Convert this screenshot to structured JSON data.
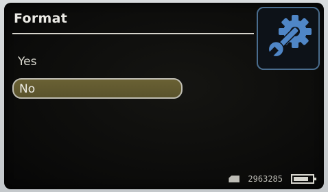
{
  "screen": {
    "title": "Format",
    "header_icon": "wrench-gear-icon"
  },
  "menu": {
    "items": [
      {
        "label": "Yes",
        "selected": false
      },
      {
        "label": "No",
        "selected": true
      }
    ]
  },
  "status": {
    "card_icon": "sd-card-icon",
    "remaining_count": "2963285",
    "battery_level": 0.8
  },
  "colors": {
    "background": "#0b0b0a",
    "text": "#dcdbd2",
    "highlight_fill": "#5f5730",
    "icon_blue": "#4f86c6"
  }
}
